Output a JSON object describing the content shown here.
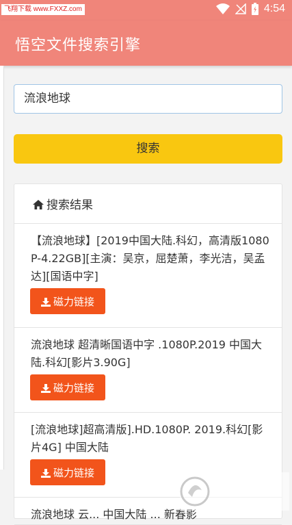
{
  "status": {
    "watermark": "飞翔下载 www.FXXZ.com",
    "time": "4:54"
  },
  "app": {
    "title": "悟空文件搜索引擎"
  },
  "search": {
    "value": "流浪地球",
    "button_label": "搜索"
  },
  "results": {
    "header": "搜索结果",
    "magnet_label": "磁力链接",
    "items": [
      {
        "title": "【流浪地球】[2019中国大陆.科幻，高清版1080P-4.22GB][主演：吴京，屈楚萧，李光洁，吴孟达][国语中字]"
      },
      {
        "title": "流浪地球 超清晰国语中字 .1080P.2019 中国大陆.科幻[影片3.90G]"
      },
      {
        "title": "[流浪地球]超高清版].HD.1080P. 2019.科幻[影片4G] 中国大陆"
      },
      {
        "title": "流浪地球 云... 中国大陆 ... 新春影"
      }
    ]
  },
  "colors": {
    "appbar": "#f0857a",
    "search_button": "#f9c710",
    "magnet_button": "#f2541b",
    "input_border": "#9fc4e6"
  }
}
